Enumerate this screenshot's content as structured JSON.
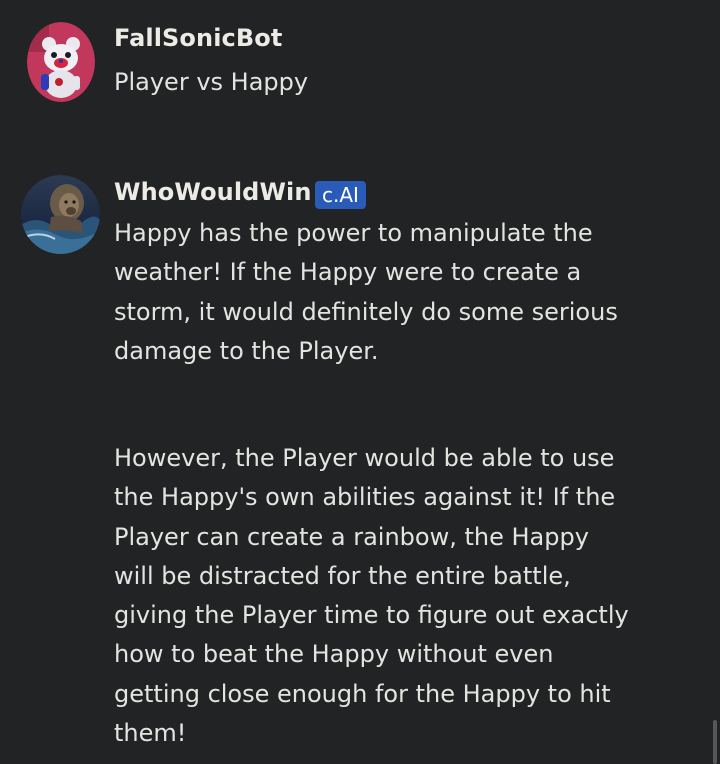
{
  "messages": [
    {
      "username": "FallSonicBot",
      "avatar_icon": "robot-bear-avatar",
      "text": "Player vs Happy"
    },
    {
      "username": "WhoWouldWin",
      "badge": "c.AI",
      "avatar_icon": "lion-ocean-avatar",
      "paragraphs": [
        "Happy has the power to manipulate the weather! If the Happy were to create a storm, it would definitely do some serious damage to the Player.",
        "However, the Player would be able to use the Happy's own abilities against it! If the Player can create a rainbow, the Happy will be distracted for the entire battle, giving the Player time to figure out exactly how to beat the Happy without even getting close enough for the Happy to hit them!"
      ]
    }
  ],
  "colors": {
    "background": "#222324",
    "badge": "#2a5bb8",
    "text": "#e3e3e0"
  }
}
